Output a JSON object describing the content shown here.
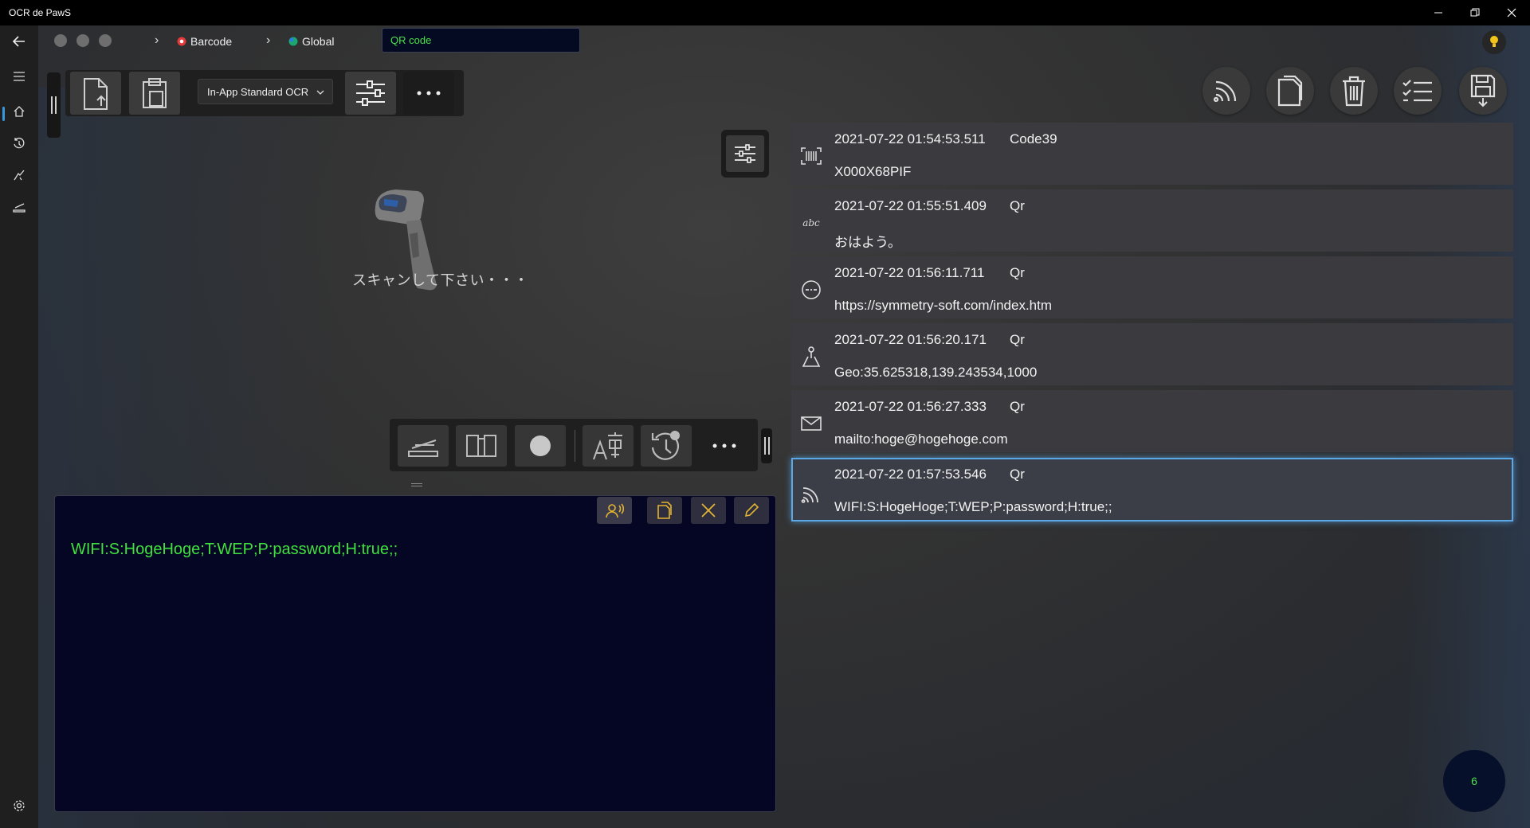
{
  "window": {
    "title": "OCR de PawS"
  },
  "breadcrumb": {
    "item1": "Barcode",
    "item2": "Global"
  },
  "search": {
    "value": "QR code"
  },
  "toolbar": {
    "ocr_engine": "In-App Standard OCR"
  },
  "scanner": {
    "prompt": "スキャンして下さい・・・"
  },
  "output": {
    "text": "WIFI:S:HogeHoge;T:WEP;P:password;H:true;;"
  },
  "results": [
    {
      "timestamp": "2021-07-22 01:54:53.511",
      "type": "Code39",
      "value": "X000X68PIF",
      "icon": "barcode-icon"
    },
    {
      "timestamp": "2021-07-22 01:55:51.409",
      "type": "Qr",
      "value": "おはよう。",
      "icon": "text-abc-icon"
    },
    {
      "timestamp": "2021-07-22 01:56:11.711",
      "type": "Qr",
      "value": "https://symmetry-soft.com/index.htm",
      "icon": "link-icon"
    },
    {
      "timestamp": "2021-07-22 01:56:20.171",
      "type": "Qr",
      "value": "Geo:35.625318,139.243534,1000",
      "icon": "map-pin-icon"
    },
    {
      "timestamp": "2021-07-22 01:56:27.333",
      "type": "Qr",
      "value": "mailto:hoge@hogehoge.com",
      "icon": "mail-icon"
    },
    {
      "timestamp": "2021-07-22 01:57:53.546",
      "type": "Qr",
      "value": "WIFI:S:HogeHoge;T:WEP;P:password;H:true;;",
      "icon": "wifi-icon"
    }
  ],
  "badge": {
    "count": "6"
  },
  "colors": {
    "accent_green": "#4ae24a",
    "selection": "#5aa8e8",
    "output_bg": "#050623"
  }
}
